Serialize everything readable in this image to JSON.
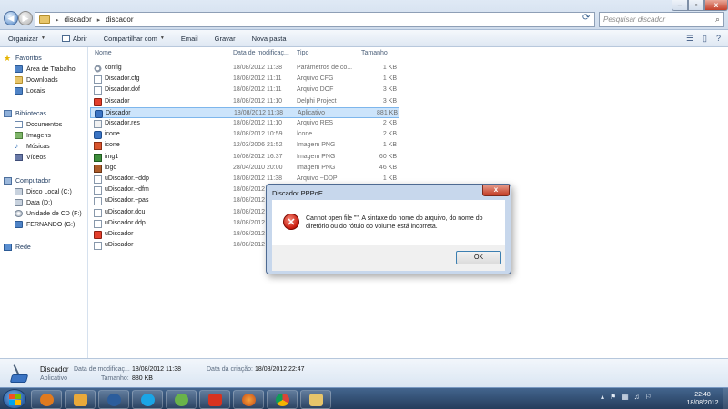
{
  "address": {
    "segments": [
      "discador",
      "discador"
    ]
  },
  "search": {
    "placeholder": "Pesquisar discador"
  },
  "toolbar": {
    "organize": "Organizar",
    "open": "Abrir",
    "share": "Compartilhar com",
    "email": "Email",
    "burn": "Gravar",
    "new_folder": "Nova pasta"
  },
  "sidebar": {
    "favorites": "Favoritos",
    "desktop": "Área de Trabalho",
    "downloads": "Downloads",
    "places": "Locais",
    "libraries": "Bibliotecas",
    "documents": "Documentos",
    "images": "Imagens",
    "music": "Músicas",
    "videos": "Vídeos",
    "computer": "Computador",
    "disk_c": "Disco Local (C:)",
    "disk_d": "Data (D:)",
    "disk_f": "Unidade de CD (F:)",
    "disk_g": "FERNANDO (G:)",
    "network": "Rede"
  },
  "columns": {
    "name": "Nome",
    "date": "Data de modificaç...",
    "type": "Tipo",
    "size": "Tamanho"
  },
  "files": [
    {
      "name": "config",
      "date": "18/08/2012 11:38",
      "type": "Parâmetros de co...",
      "size": "1 KB",
      "icon": "gear-file-icon"
    },
    {
      "name": "Discador.cfg",
      "date": "18/08/2012 11:11",
      "type": "Arquivo CFG",
      "size": "1 KB",
      "icon": "document-icon"
    },
    {
      "name": "Discador.dof",
      "date": "18/08/2012 11:11",
      "type": "Arquivo DOF",
      "size": "3 KB",
      "icon": "document-icon"
    },
    {
      "name": "Discador",
      "date": "18/08/2012 11:10",
      "type": "Delphi Project",
      "size": "3 KB",
      "icon": "delphi-project-icon"
    },
    {
      "name": "Discador",
      "date": "18/08/2012 11:38",
      "type": "Aplicativo",
      "size": "881 KB",
      "icon": "application-icon"
    },
    {
      "name": "Discador.res",
      "date": "18/08/2012 11:10",
      "type": "Arquivo RES",
      "size": "2 KB",
      "icon": "resource-icon"
    },
    {
      "name": "icone",
      "date": "18/08/2012 10:59",
      "type": "Ícone",
      "size": "2 KB",
      "icon": "app-icon-file"
    },
    {
      "name": "icone",
      "date": "12/03/2006 21:52",
      "type": "Imagem PNG",
      "size": "1 KB",
      "icon": "png-icon"
    },
    {
      "name": "img1",
      "date": "10/08/2012 16:37",
      "type": "Imagem PNG",
      "size": "60 KB",
      "icon": "png-icon"
    },
    {
      "name": "logo",
      "date": "28/04/2010 20:00",
      "type": "Imagem PNG",
      "size": "46 KB",
      "icon": "png-icon"
    },
    {
      "name": "uDiscador.~ddp",
      "date": "18/08/2012 11:38",
      "type": "Arquivo ~DDP",
      "size": "1 KB",
      "icon": "document-icon"
    },
    {
      "name": "uDiscador.~dfm",
      "date": "18/08/2012 11:38",
      "type": "",
      "size": "",
      "icon": "document-icon"
    },
    {
      "name": "uDiscador.~pas",
      "date": "18/08/2012 11:38",
      "type": "",
      "size": "",
      "icon": "document-icon"
    },
    {
      "name": "uDiscador.dcu",
      "date": "18/08/2012 11:38",
      "type": "",
      "size": "",
      "icon": "document-icon"
    },
    {
      "name": "uDiscador.ddp",
      "date": "18/08/2012 11:38",
      "type": "",
      "size": "",
      "icon": "document-icon"
    },
    {
      "name": "uDiscador",
      "date": "18/08/2012 11:38",
      "type": "",
      "size": "",
      "icon": "delphi-form-icon"
    },
    {
      "name": "uDiscador",
      "date": "18/08/2012 11:38",
      "type": "",
      "size": "",
      "icon": "delphi-unit-icon"
    }
  ],
  "dialog": {
    "title": "Discador PPPoE",
    "message": "Cannot open file \"\". A sintaxe do nome do arquivo, do nome do diretório ou do rótulo do volume está incorreta.",
    "ok": "OK"
  },
  "details": {
    "name": "Discador",
    "kind": "Aplicativo",
    "modified_label": "Data de modificaç...",
    "modified_value": "18/08/2012 11:38",
    "size_label": "Tamanho:",
    "size_value": "880 KB",
    "created_label": "Data da criação:",
    "created_value": "18/08/2012 22:47"
  },
  "clock": {
    "time": "22:48",
    "date": "18/08/2012"
  },
  "colors": {
    "selection": "#cce4fb",
    "dialog_frame": "#c7d7ec",
    "taskbar": "#2f4b70"
  }
}
